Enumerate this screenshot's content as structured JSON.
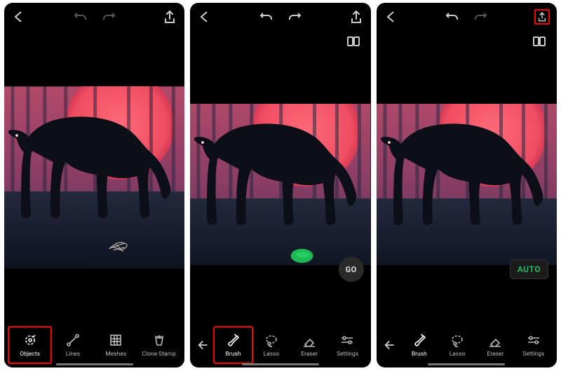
{
  "screens": [
    {
      "id": "screen1",
      "topbar": {
        "undo_enabled": false,
        "redo_enabled": false,
        "export_highlight": false
      },
      "has_subbar": false,
      "toolbar_mode": "main",
      "badge": null,
      "overlay": "scribble",
      "tools": [
        {
          "key": "objects",
          "label": "Objects",
          "icon": "objects",
          "active": true,
          "highlight": true
        },
        {
          "key": "lines",
          "label": "Lines",
          "icon": "lines",
          "active": false,
          "highlight": false
        },
        {
          "key": "meshes",
          "label": "Meshes",
          "icon": "meshes",
          "active": false,
          "highlight": false
        },
        {
          "key": "clonestamp",
          "label": "Clone Stamp",
          "icon": "clonestamp",
          "active": false,
          "highlight": false
        }
      ]
    },
    {
      "id": "screen2",
      "topbar": {
        "undo_enabled": true,
        "redo_enabled": true,
        "export_highlight": false
      },
      "has_subbar": true,
      "toolbar_mode": "brush",
      "badge": {
        "text": "GO",
        "style": "round"
      },
      "overlay": "green_blob",
      "tools": [
        {
          "key": "brush",
          "label": "Brush",
          "icon": "brush",
          "active": true,
          "highlight": true
        },
        {
          "key": "lasso",
          "label": "Lasso",
          "icon": "lasso",
          "active": false,
          "highlight": false
        },
        {
          "key": "eraser",
          "label": "Eraser",
          "icon": "eraser",
          "active": false,
          "highlight": false
        },
        {
          "key": "settings",
          "label": "Settings",
          "icon": "settings",
          "active": false,
          "highlight": false
        }
      ]
    },
    {
      "id": "screen3",
      "topbar": {
        "undo_enabled": true,
        "redo_enabled": false,
        "export_highlight": true
      },
      "has_subbar": true,
      "toolbar_mode": "brush",
      "badge": {
        "text": "AUTO",
        "style": "rect"
      },
      "overlay": null,
      "tools": [
        {
          "key": "brush",
          "label": "Brush",
          "icon": "brush",
          "active": true,
          "highlight": false
        },
        {
          "key": "lasso",
          "label": "Lasso",
          "icon": "lasso",
          "active": false,
          "highlight": false
        },
        {
          "key": "eraser",
          "label": "Eraser",
          "icon": "eraser",
          "active": false,
          "highlight": false
        },
        {
          "key": "settings",
          "label": "Settings",
          "icon": "settings",
          "active": false,
          "highlight": false
        }
      ]
    }
  ],
  "icons": {
    "back_chevron": "chevron-left",
    "undo": "undo",
    "redo": "redo",
    "export": "export",
    "compare": "compare",
    "arrow_left": "arrow-left"
  },
  "labels": {
    "go": "GO",
    "auto": "AUTO"
  }
}
